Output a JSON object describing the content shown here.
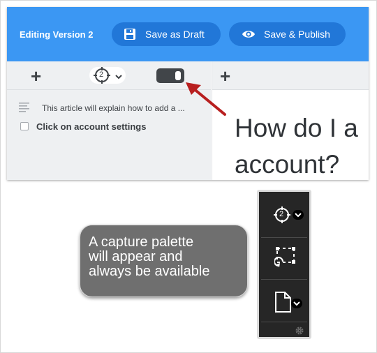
{
  "editor": {
    "title": "Editing Version 2",
    "save_draft_label": "Save as Draft",
    "save_publish_label": "Save & Publish",
    "outline_items": [
      "This article will explain how to add a ...",
      "Click on account settings"
    ],
    "heading": "How do I a account?",
    "heading_line1": "How do I a",
    "heading_line2": "account?",
    "target_badge": "2",
    "colors": {
      "topbar": "#3b97f3",
      "button": "#2177d8",
      "arrow": "#b81f1f"
    }
  },
  "annotation": {
    "text_line1": "A capture palette",
    "text_line2": "will appear and",
    "text_line3": "always be available"
  },
  "palette": {
    "target_badge": "2",
    "icons": [
      "target-icon",
      "region-capture-icon",
      "document-icon",
      "gear-icon"
    ]
  }
}
